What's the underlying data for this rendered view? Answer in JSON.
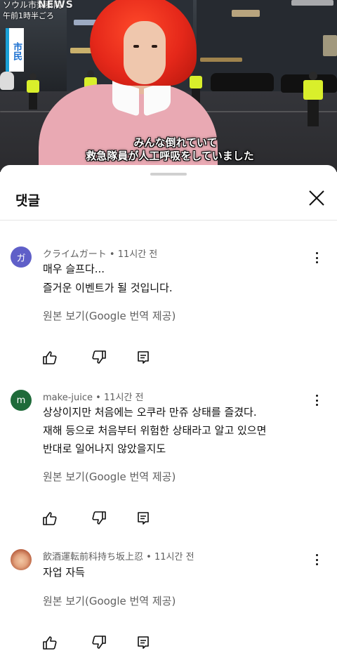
{
  "video": {
    "channel_tag": "ソウル市梨泰院",
    "brand": "NEWS",
    "time_tag": "午前1時半ごろ",
    "speaker_tag": "市民",
    "subtitle_line1": "みんな倒れていて",
    "subtitle_line2": "救急隊員が人工呼吸をしていました"
  },
  "sheet": {
    "title": "댓글",
    "translate_label": "원본 보기(Google 번역 제공)"
  },
  "comments": [
    {
      "avatar_letter": "ガ",
      "avatar_color": "#5f5fc8",
      "author": "クライムガート",
      "time": "11시간 전",
      "lines": [
        "매우 슬프다...",
        "즐거운 이벤트가 될 것입니다."
      ]
    },
    {
      "avatar_letter": "m",
      "avatar_color": "#1f6b3a",
      "author": "make-juice",
      "time": "11시간 전",
      "lines": [
        "상상이지만 처음에는 오쿠라 만쥬 상태를 즐겼다.",
        "재해 등으로 처음부터 위험한 상태라고 알고 있으면",
        "반대로 일어나지 않았을지도"
      ]
    },
    {
      "avatar_letter": "",
      "avatar_color": "#d98a5a",
      "author": "飲酒運転前科持ち坂上忍",
      "time": "11시간 전",
      "lines": [
        "자업 자득"
      ]
    }
  ],
  "icons": [
    "like-icon",
    "dislike-icon",
    "reply-icon",
    "more-vert-icon",
    "close-icon"
  ]
}
